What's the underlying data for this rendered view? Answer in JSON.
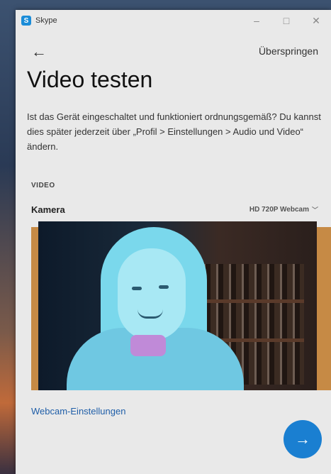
{
  "window": {
    "app_name": "Skype",
    "app_logo_glyph": "S",
    "controls": {
      "minimize": "–",
      "maximize": "□",
      "close": "✕"
    }
  },
  "nav": {
    "back_icon": "arrow-left-icon",
    "back_glyph": "←",
    "skip_label": "Überspringen"
  },
  "main": {
    "title": "Video testen",
    "description": "Ist das Gerät eingeschaltet und funktioniert ordnungsgemäß? Du kannst dies später jederzeit über „Profil > Einstellungen > Audio und Video“ ändern.",
    "section_label": "VIDEO",
    "camera": {
      "label": "Kamera",
      "selected_device": "HD 720P Webcam",
      "chevron_glyph": "﹀"
    },
    "webcam_settings_link": "Webcam-Einstellungen",
    "next_button": {
      "icon": "arrow-right-icon",
      "glyph": "→"
    }
  },
  "colors": {
    "accent": "#1a7fd1",
    "link": "#1f5ea8",
    "window_bg": "#e9e9e9",
    "skype_blue": "#1a8cd8"
  }
}
